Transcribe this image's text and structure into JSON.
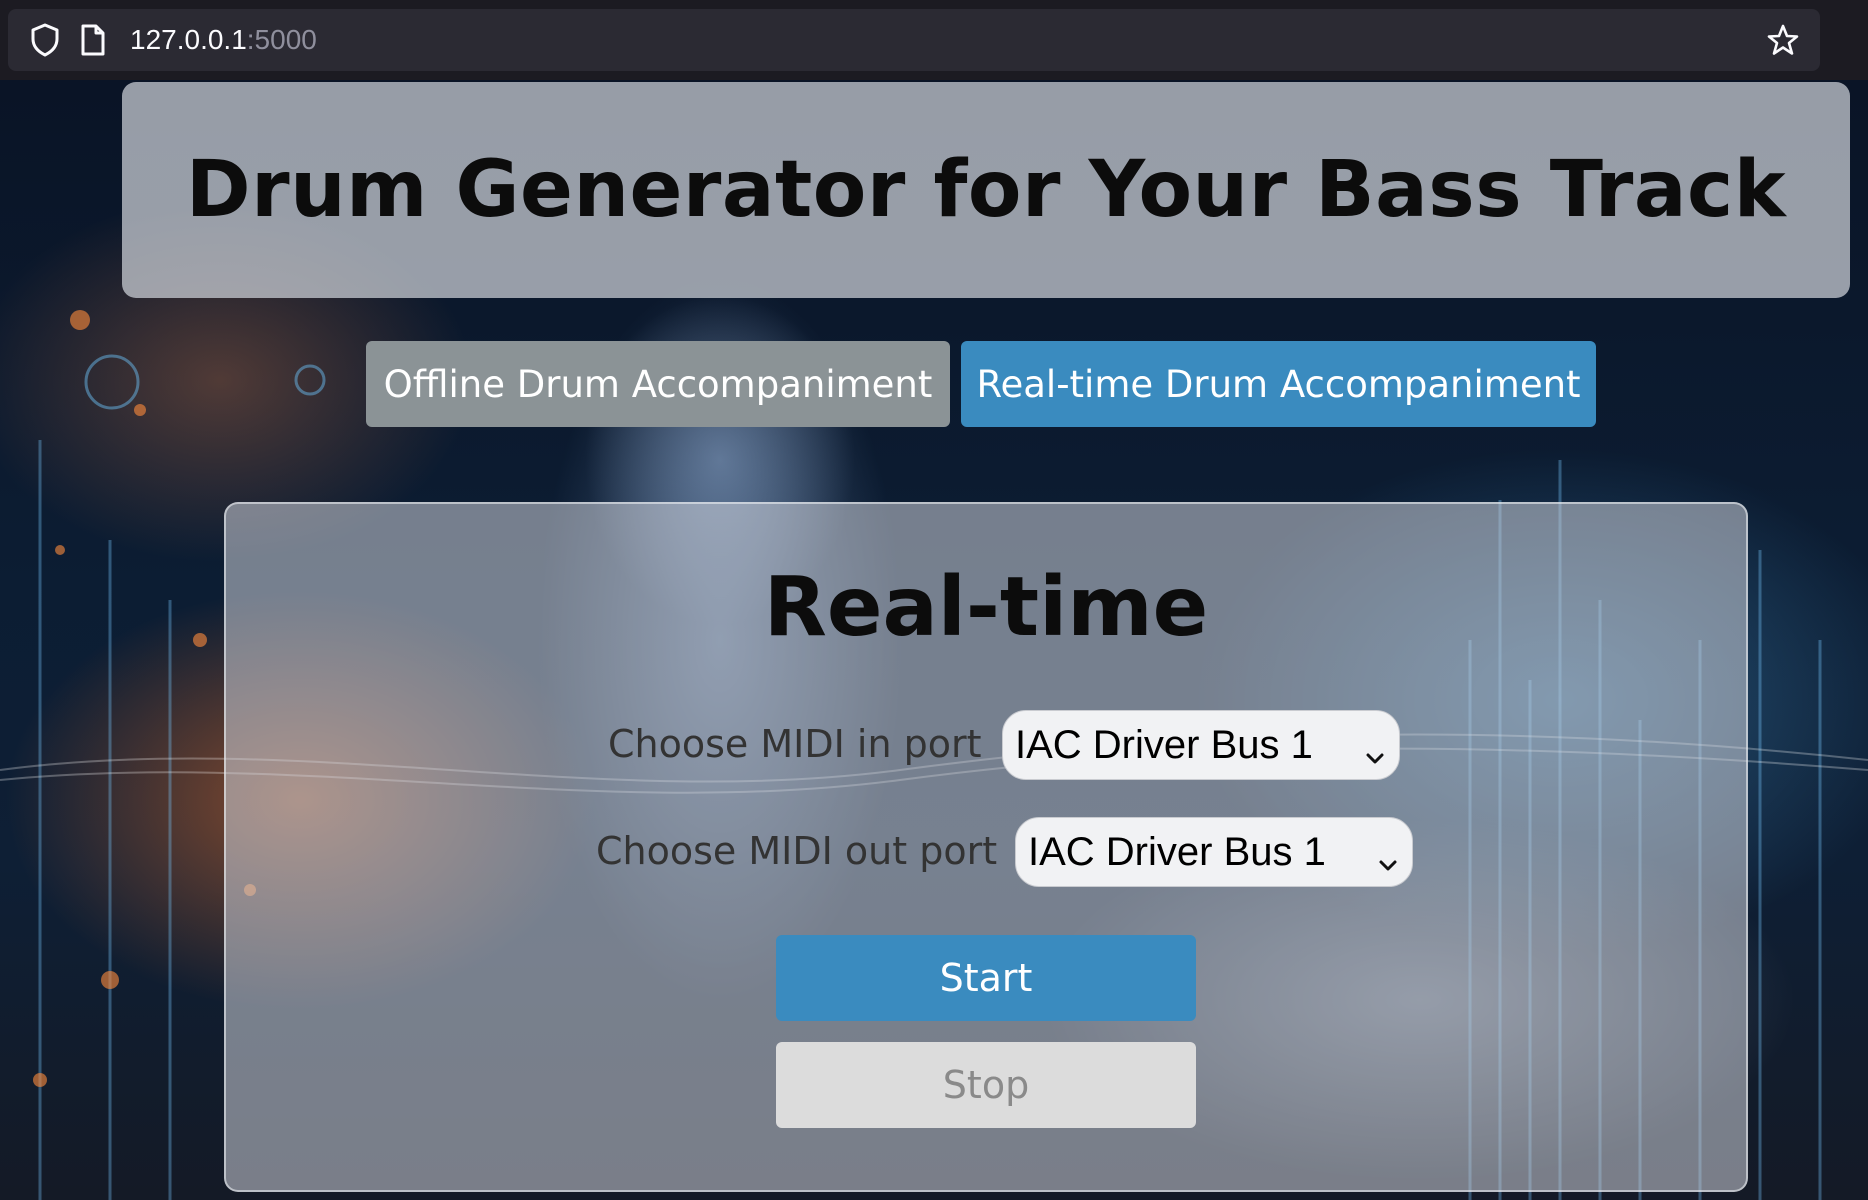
{
  "browser": {
    "url_host": "127.0.0.1",
    "url_port": ":5000"
  },
  "header": {
    "title": "Drum Generator for Your Bass Track"
  },
  "tabs": [
    {
      "label": "Offline Drum Accompaniment",
      "active": false
    },
    {
      "label": "Real-time Drum Accompaniment",
      "active": true
    }
  ],
  "realtime": {
    "title": "Real-time",
    "midi_in": {
      "label": "Choose MIDI in port",
      "value": "IAC Driver Bus 1"
    },
    "midi_out": {
      "label": "Choose MIDI out port",
      "value": "IAC Driver Bus 1"
    },
    "start_label": "Start",
    "stop_label": "Stop"
  },
  "colors": {
    "accent": "#3a8bbf",
    "tab_inactive": "#8b9396",
    "disabled": "#dcdcdc"
  },
  "icons": [
    "shield-icon",
    "page-icon",
    "bookmark-star-icon",
    "chevron-down-icon"
  ]
}
